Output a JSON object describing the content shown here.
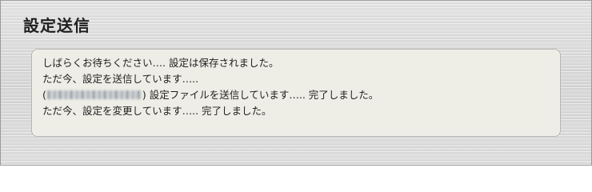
{
  "page": {
    "title": "設定送信"
  },
  "message": {
    "lines": [
      "しばらくお待ちください…. 設定は保存されました。",
      "ただ今、設定を送信しています…..",
      {
        "prefix": "(",
        "redacted_device": "blurred-device-address",
        "suffix": ") 設定ファイルを送信しています….. 完了しました。"
      },
      "ただ今、設定を変更しています….. 完了しました。"
    ]
  }
}
